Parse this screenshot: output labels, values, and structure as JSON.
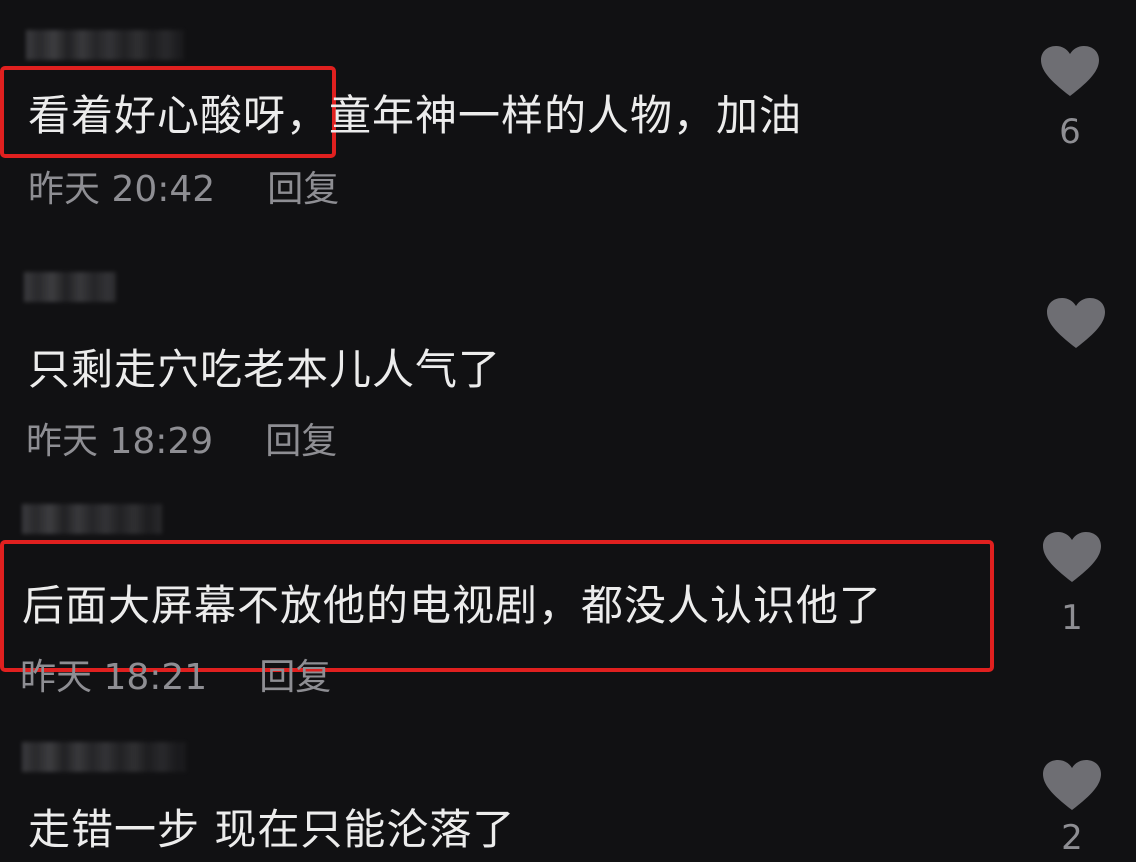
{
  "comments": [
    {
      "text": "看着好心酸呀，童年神一样的人物，加油",
      "time": "昨天 20:42",
      "reply_label": "回复",
      "likes": "6",
      "highlighted": true
    },
    {
      "text": "只剩走穴吃老本儿人气了",
      "time": "昨天 18:29",
      "reply_label": "回复",
      "likes": "",
      "highlighted": false
    },
    {
      "text": "后面大屏幕不放他的电视剧，都没人认识他了",
      "time": "昨天 18:21",
      "reply_label": "回复",
      "likes": "1",
      "highlighted": true
    },
    {
      "text": "走错一步 现在只能沦落了",
      "time": "",
      "reply_label": "",
      "likes": "2",
      "highlighted": false
    }
  ],
  "colors": {
    "background": "#111113",
    "text": "#ececec",
    "meta": "#8e8e93",
    "highlight": "#e0201f",
    "heart": "#6e6e73"
  },
  "icons": {
    "like": "heart-icon"
  }
}
